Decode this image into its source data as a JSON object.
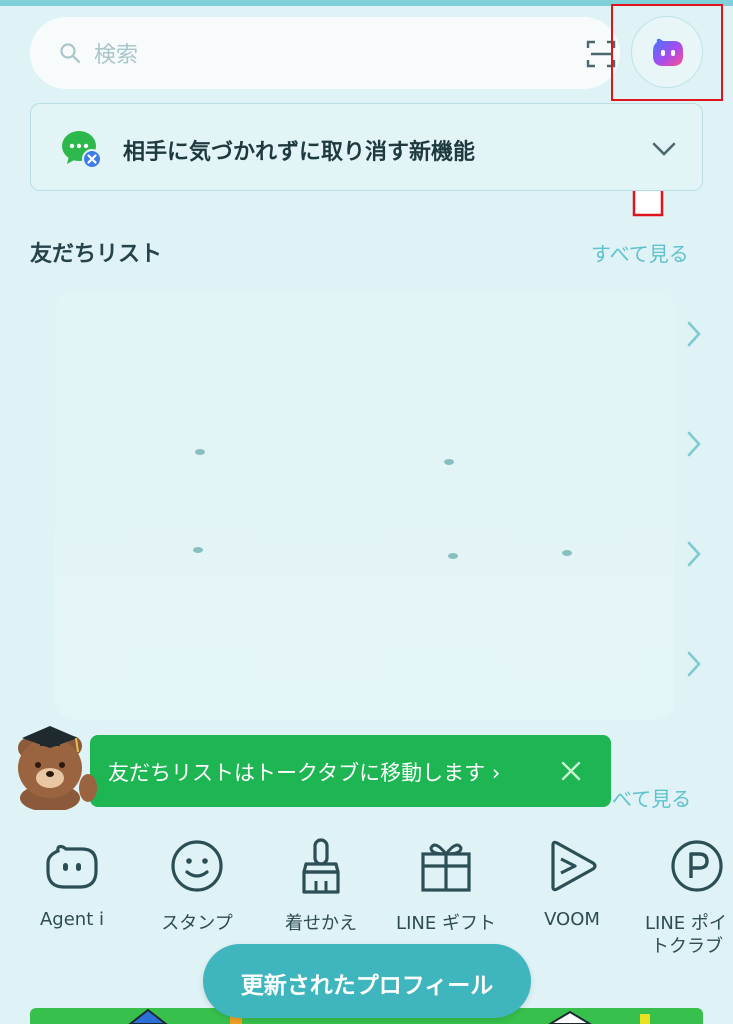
{
  "search": {
    "placeholder": "検索",
    "icon": "search-icon",
    "scan_icon": "qr-scan-icon"
  },
  "agent_button": {
    "icon": "agent-i-icon"
  },
  "notice": {
    "text": "相手に気づかれずに取り消す新機能"
  },
  "friends": {
    "title": "友だちリスト",
    "see_all": "すべて見る"
  },
  "toast": {
    "text": "友だちリストはトークタブに移動します ›"
  },
  "second_section": {
    "see_all": "べて見る"
  },
  "services": [
    {
      "label": "Agent i",
      "icon": "agent-i-icon"
    },
    {
      "label": "スタンプ",
      "icon": "smile-icon"
    },
    {
      "label": "着せかえ",
      "icon": "brush-icon"
    },
    {
      "label": "LINE ギフト",
      "icon": "gift-icon"
    },
    {
      "label": "VOOM",
      "icon": "play-icon"
    },
    {
      "label": "LINE ポイ",
      "label2": "トクラブ",
      "icon": "points-icon"
    }
  ],
  "fab": {
    "label": "更新されたプロフィール"
  },
  "colors": {
    "background": "#dff2f5",
    "accent": "#5fc2cc",
    "toast": "#1db653",
    "highlight": "#e0141c"
  }
}
